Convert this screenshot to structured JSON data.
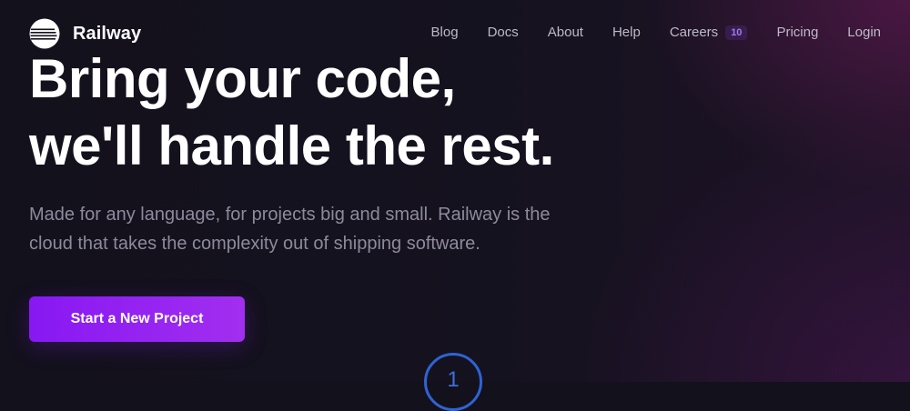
{
  "brand": {
    "name": "Railway",
    "icon": "railway-logo-icon"
  },
  "nav": {
    "items": [
      {
        "label": "Blog"
      },
      {
        "label": "Docs"
      },
      {
        "label": "About"
      },
      {
        "label": "Help"
      },
      {
        "label": "Careers",
        "badge": "10"
      },
      {
        "label": "Pricing"
      },
      {
        "label": "Login"
      }
    ]
  },
  "hero": {
    "headline_line1": "Bring your code,",
    "headline_line2": "we'll handle the rest.",
    "subtitle": "Made for any language, for projects big and small. Railway is the cloud that takes the complexity out of shipping software.",
    "cta_label": "Start a New Project"
  },
  "step": {
    "number": "1"
  },
  "colors": {
    "background": "#13111c",
    "accent": "#8718f2",
    "accent_end": "#a22ef0",
    "nav_text": "#bdbac7",
    "subtitle_text": "#8e8a9c",
    "badge_text": "#a278f5",
    "step_ring": "#2f62d6"
  }
}
